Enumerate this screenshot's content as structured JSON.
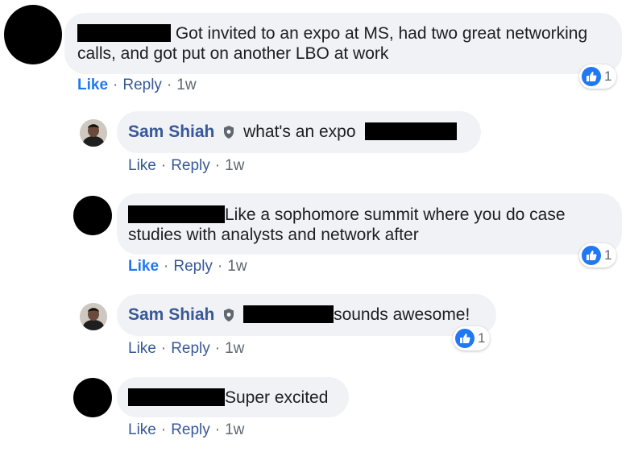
{
  "comments": [
    {
      "text": "Got invited to an expo at MS, had two great networking calls, and got put on another LBO at work",
      "actions": {
        "like": "Like",
        "reply": "Reply",
        "time": "1w"
      },
      "reactions": "1"
    },
    {
      "author": "Sam Shiah",
      "text": "what's an expo",
      "actions": {
        "like": "Like",
        "reply": "Reply",
        "time": "1w"
      }
    },
    {
      "text": "Like a sophomore summit where you do case studies with analysts and network after",
      "actions": {
        "like": "Like",
        "reply": "Reply",
        "time": "1w"
      },
      "reactions": "1"
    },
    {
      "author": "Sam Shiah",
      "text": "sounds awesome!",
      "actions": {
        "like": "Like",
        "reply": "Reply",
        "time": "1w"
      },
      "reactions": "1"
    },
    {
      "text": "Super excited",
      "actions": {
        "like": "Like",
        "reply": "Reply",
        "time": "1w"
      }
    }
  ],
  "colors": {
    "bubble": "#f0f2f5",
    "link": "#385898",
    "like_active": "#2078f4",
    "meta": "#606770"
  },
  "icons": [
    "like-reaction-icon",
    "verified-shield-icon",
    "avatar"
  ]
}
